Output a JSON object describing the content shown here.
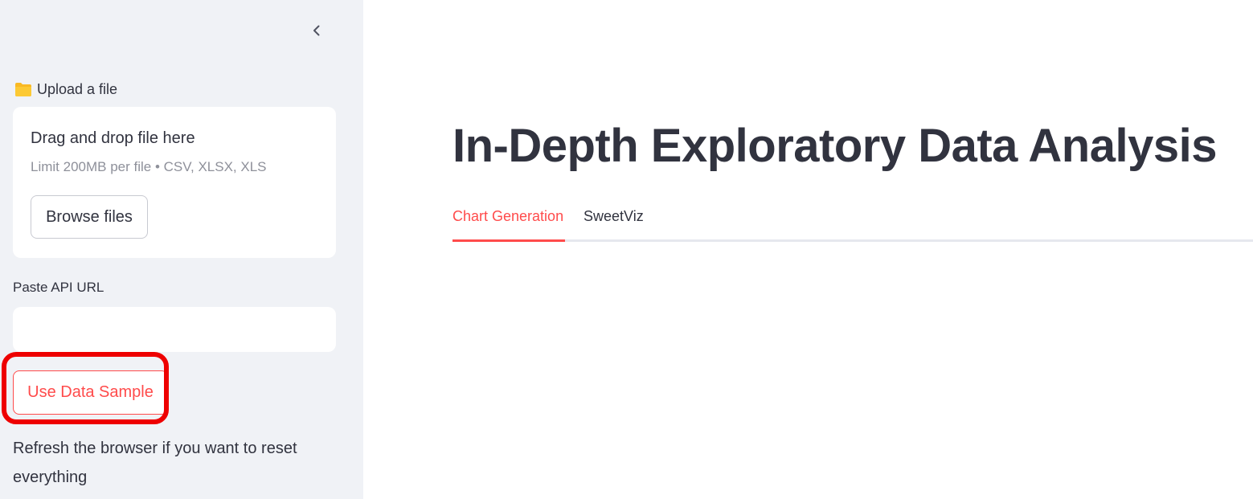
{
  "sidebar": {
    "collapse_icon": "chevron-left-icon",
    "upload": {
      "icon": "folder-icon",
      "label": "Upload a file",
      "drop_title": "Drag and drop file here",
      "limit_text": "Limit 200MB per file • CSV, XLSX, XLS",
      "browse_label": "Browse files"
    },
    "api": {
      "label": "Paste API URL",
      "value": "",
      "placeholder": ""
    },
    "sample_button_label": "Use Data Sample",
    "refresh_note": "Refresh the browser if you want to reset everything"
  },
  "main": {
    "title": "In-Depth Exploratory Data Analysis",
    "tabs": [
      {
        "label": "Chart Generation",
        "active": true
      },
      {
        "label": "SweetViz",
        "active": false
      }
    ]
  },
  "colors": {
    "accent": "#ff4b4b",
    "sidebar_bg": "#f0f2f6",
    "text": "#31333f",
    "highlight": "#ee0000"
  }
}
